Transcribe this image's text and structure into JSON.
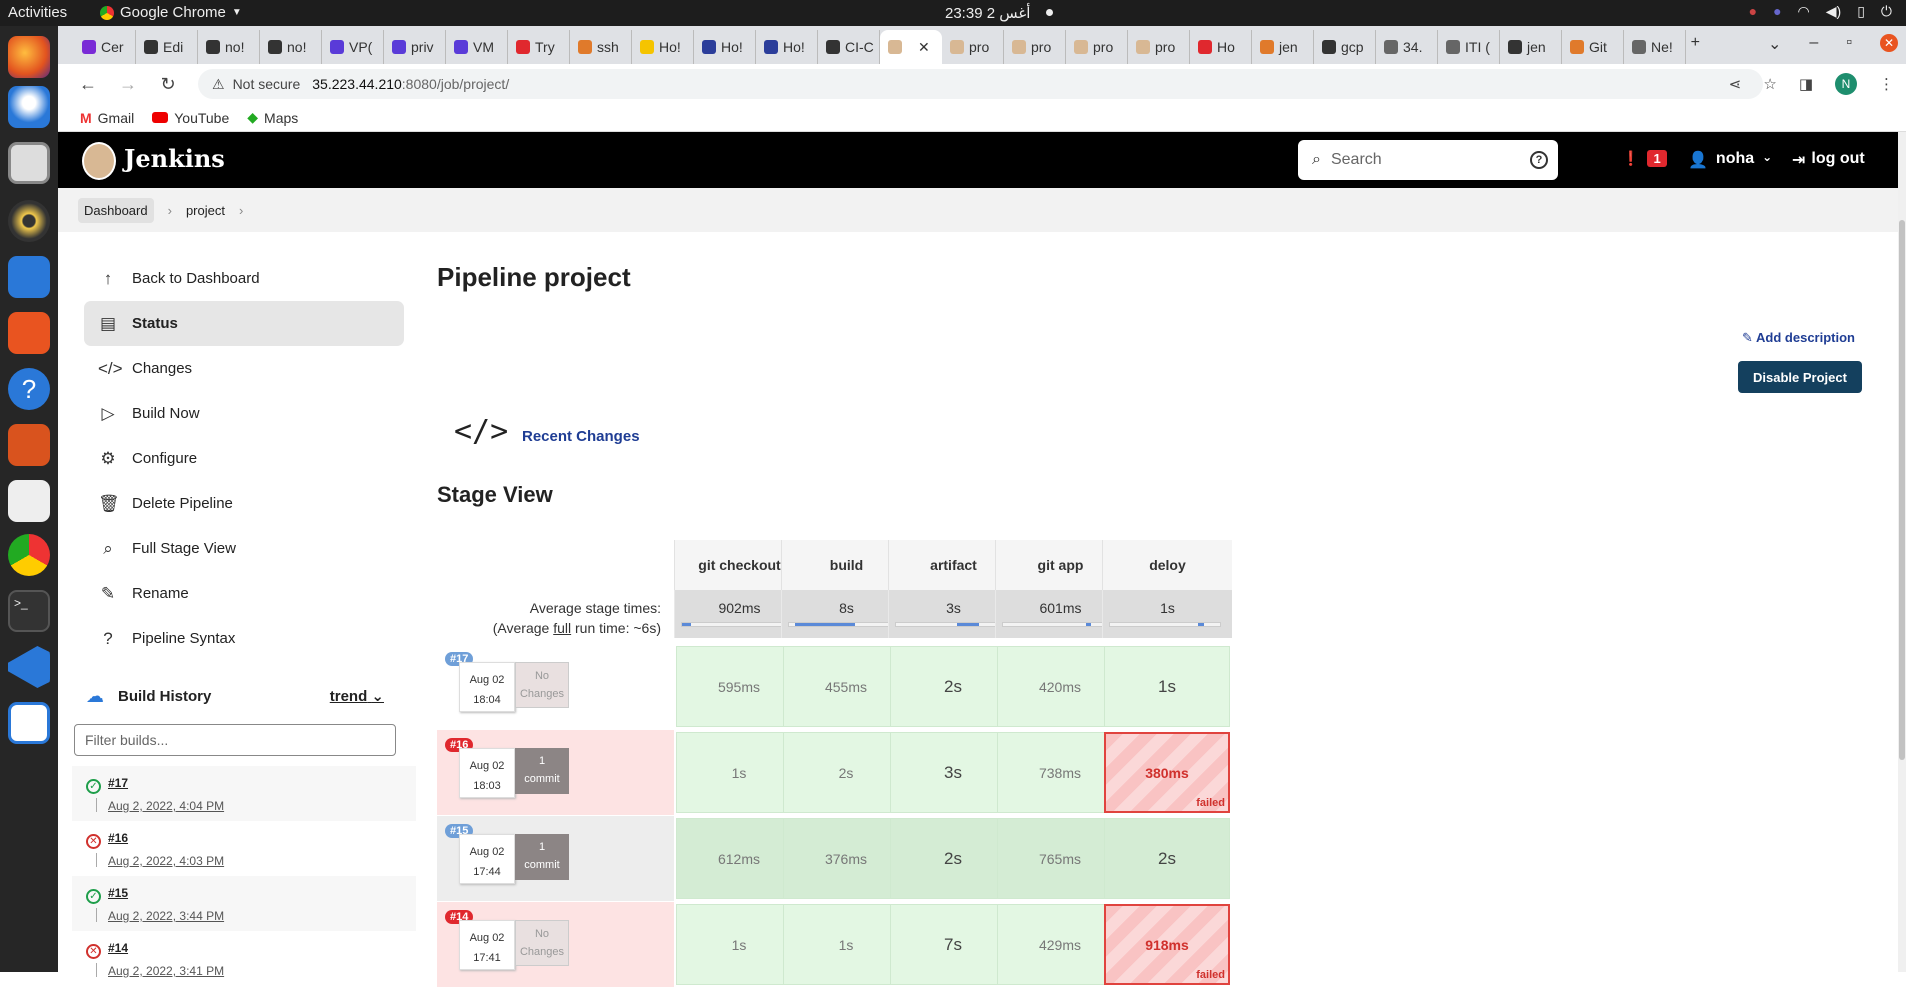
{
  "os": {
    "activities": "Activities",
    "app_menu": "Google Chrome",
    "clock": "أغس 2  23:39"
  },
  "browser": {
    "tabs": [
      {
        "label": "Cer",
        "color": "#7a2bd6"
      },
      {
        "label": "Edi",
        "color": "#333333"
      },
      {
        "label": "no!",
        "color": "#333333"
      },
      {
        "label": "no!",
        "color": "#333333"
      },
      {
        "label": "VP(",
        "color": "#5a3bd8"
      },
      {
        "label": "priv",
        "color": "#5a3bd8"
      },
      {
        "label": "VM",
        "color": "#5a3bd8"
      },
      {
        "label": "Try",
        "color": "#e0282e"
      },
      {
        "label": "ssh",
        "color": "#e07a2b"
      },
      {
        "label": "Ho!",
        "color": "#f5c400"
      },
      {
        "label": "Ho!",
        "color": "#2b3d9a"
      },
      {
        "label": "Ho!",
        "color": "#2b3d9a"
      },
      {
        "label": "CI-C",
        "color": "#333333"
      },
      {
        "label": "",
        "color": "#d8b894",
        "active": true
      },
      {
        "label": "pro",
        "color": "#d8b894"
      },
      {
        "label": "pro",
        "color": "#d8b894"
      },
      {
        "label": "pro",
        "color": "#d8b894"
      },
      {
        "label": "pro",
        "color": "#d8b894"
      },
      {
        "label": "Ho",
        "color": "#e0282e"
      },
      {
        "label": "jen",
        "color": "#e07a2b"
      },
      {
        "label": "gcp",
        "color": "#333333"
      },
      {
        "label": "34.",
        "color": "#666666"
      },
      {
        "label": "ITI (",
        "color": "#666666"
      },
      {
        "label": "jen",
        "color": "#333333"
      },
      {
        "label": "Git",
        "color": "#e07a2b"
      },
      {
        "label": "Ne!",
        "color": "#666666"
      }
    ],
    "not_secure": "Not secure",
    "url_host": "35.223.44.210",
    "url_path": ":8080/job/project/",
    "bookmarks": [
      "Gmail",
      "YouTube",
      "Maps"
    ],
    "profile_initial": "N"
  },
  "jenkins": {
    "title": "Jenkins",
    "search_placeholder": "Search",
    "alert_count": "1",
    "user": "noha",
    "logout": "log out",
    "breadcrumbs": [
      "Dashboard",
      "project"
    ]
  },
  "sidebar": {
    "items": [
      {
        "label": "Back to Dashboard",
        "icon": "↑"
      },
      {
        "label": "Status",
        "icon": "▤"
      },
      {
        "label": "Changes",
        "icon": "</>"
      },
      {
        "label": "Build Now",
        "icon": "▷"
      },
      {
        "label": "Configure",
        "icon": "⚙"
      },
      {
        "label": "Delete Pipeline",
        "icon": "🗑"
      },
      {
        "label": "Full Stage View",
        "icon": "⌕"
      },
      {
        "label": "Rename",
        "icon": "✎"
      },
      {
        "label": "Pipeline Syntax",
        "icon": "?"
      }
    ]
  },
  "build_history": {
    "title": "Build History",
    "trend": "trend",
    "filter_placeholder": "Filter builds...",
    "builds": [
      {
        "num": "#17",
        "date": "Aug 2, 2022, 4:04 PM",
        "status": "success"
      },
      {
        "num": "#16",
        "date": "Aug 2, 2022, 4:03 PM",
        "status": "failed"
      },
      {
        "num": "#15",
        "date": "Aug 2, 2022, 3:44 PM",
        "status": "success"
      },
      {
        "num": "#14",
        "date": "Aug 2, 2022, 3:41 PM",
        "status": "failed"
      }
    ]
  },
  "main": {
    "title": "Pipeline project",
    "add_description": "Add description",
    "disable_button": "Disable Project",
    "recent_changes": "Recent Changes",
    "stage_view_title": "Stage View"
  },
  "stage_view": {
    "stages": [
      "git checkout",
      "build",
      "artifact",
      "git app",
      "deloy"
    ],
    "avg_label_1": "Average stage times:",
    "avg_label_2a": "(Average ",
    "avg_label_2b": "full",
    "avg_label_2c": " run time: ~6s)",
    "averages": [
      "902ms",
      "8s",
      "3s",
      "601ms",
      "1s"
    ],
    "avg_progress": [
      {
        "start": 0,
        "end": 0.08
      },
      {
        "start": 0.05,
        "end": 0.6
      },
      {
        "start": 0.55,
        "end": 0.75
      },
      {
        "start": 0.75,
        "end": 0.8
      },
      {
        "start": 0.8,
        "end": 0.85
      }
    ],
    "failed_label": "failed",
    "rows": [
      {
        "id": "#17",
        "id_color": "#6f9fd8",
        "month_day": "Aug 02",
        "time": "18:04",
        "changes": "No\nChanges",
        "changes_type": "none",
        "row_bg": "#ffffff",
        "cells": [
          "595ms",
          "455ms",
          "2s",
          "420ms",
          "1s"
        ],
        "failed": [
          false,
          false,
          false,
          false,
          false
        ]
      },
      {
        "id": "#16",
        "id_color": "#e0282e",
        "month_day": "Aug 02",
        "time": "18:03",
        "changes": "1\ncommit",
        "changes_type": "commit",
        "row_bg": "#fde3e3",
        "cells": [
          "1s",
          "2s",
          "3s",
          "738ms",
          "380ms"
        ],
        "failed": [
          false,
          false,
          false,
          false,
          true
        ]
      },
      {
        "id": "#15",
        "id_color": "#6f9fd8",
        "month_day": "Aug 02",
        "time": "17:44",
        "changes": "1\ncommit",
        "changes_type": "commit",
        "row_bg": "#ededed",
        "cells": [
          "612ms",
          "376ms",
          "2s",
          "765ms",
          "2s"
        ],
        "failed": [
          false,
          false,
          false,
          false,
          false
        ]
      },
      {
        "id": "#14",
        "id_color": "#e0282e",
        "month_day": "Aug 02",
        "time": "17:41",
        "changes": "No\nChanges",
        "changes_type": "none",
        "row_bg": "#fde3e3",
        "cells": [
          "1s",
          "1s",
          "7s",
          "429ms",
          "918ms"
        ],
        "failed": [
          false,
          false,
          false,
          false,
          true
        ]
      }
    ]
  }
}
